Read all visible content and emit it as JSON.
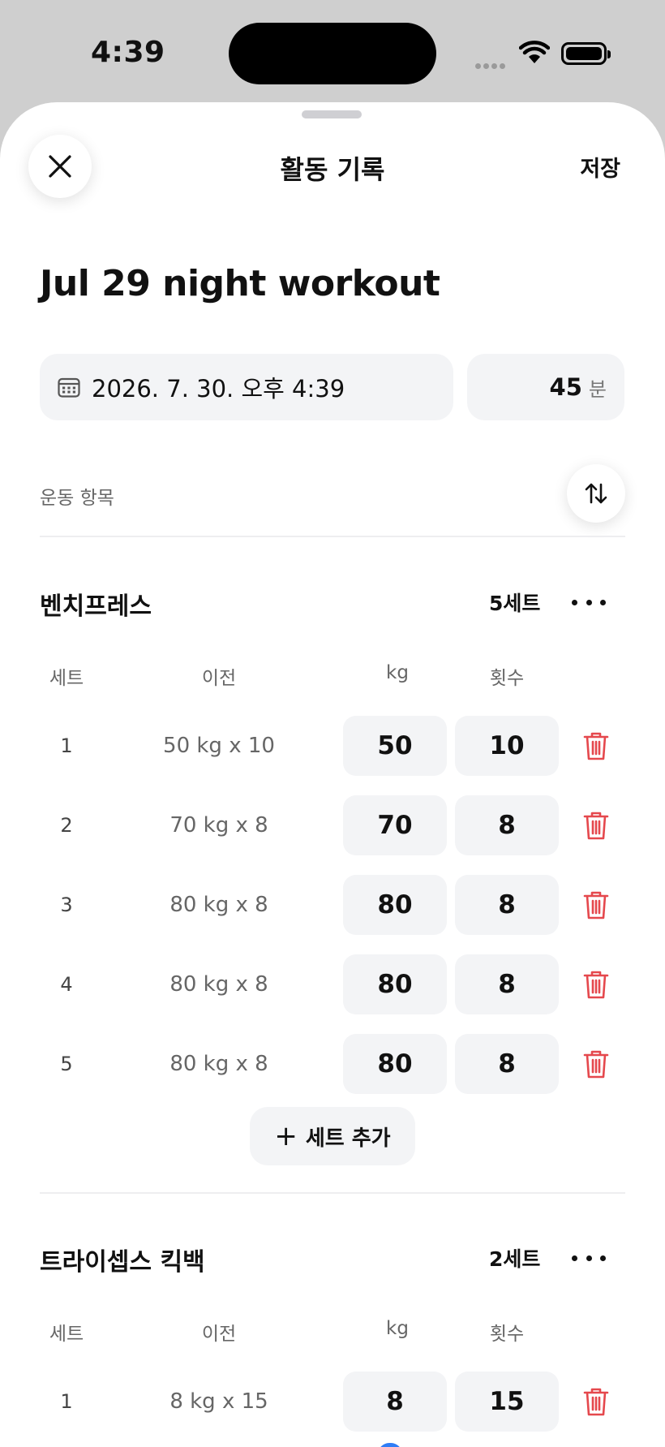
{
  "status_bar": {
    "time": "4:39"
  },
  "sheet": {
    "title": "활동 기록",
    "save_label": "저장",
    "workout_title": "Jul 29 night workout",
    "date_value": "2026. 7. 30. 오후 4:39",
    "duration_value": "45",
    "duration_unit": "분",
    "section_label": "운동 항목",
    "add_set_label": "세트 추가",
    "columns": {
      "set": "세트",
      "previous": "이전",
      "kg": "kg",
      "reps": "횟수"
    }
  },
  "exercises": [
    {
      "name": "벤치프레스",
      "sets_label": "5세트",
      "sets": [
        {
          "set": "1",
          "previous": "50 kg x 10",
          "kg": "50",
          "reps": "10"
        },
        {
          "set": "2",
          "previous": "70 kg x 8",
          "kg": "70",
          "reps": "8"
        },
        {
          "set": "3",
          "previous": "80 kg x 8",
          "kg": "80",
          "reps": "8"
        },
        {
          "set": "4",
          "previous": "80 kg x 8",
          "kg": "80",
          "reps": "8"
        },
        {
          "set": "5",
          "previous": "80 kg x 8",
          "kg": "80",
          "reps": "8"
        }
      ]
    },
    {
      "name": "트라이셉스 킥백",
      "sets_label": "2세트",
      "sets": [
        {
          "set": "1",
          "previous": "8 kg x 15",
          "kg": "8",
          "reps": "15"
        }
      ]
    }
  ],
  "colors": {
    "delete_icon": "#e5484d",
    "field_bg": "#f3f4f6",
    "scroll_indicator": "#2f7df6"
  }
}
